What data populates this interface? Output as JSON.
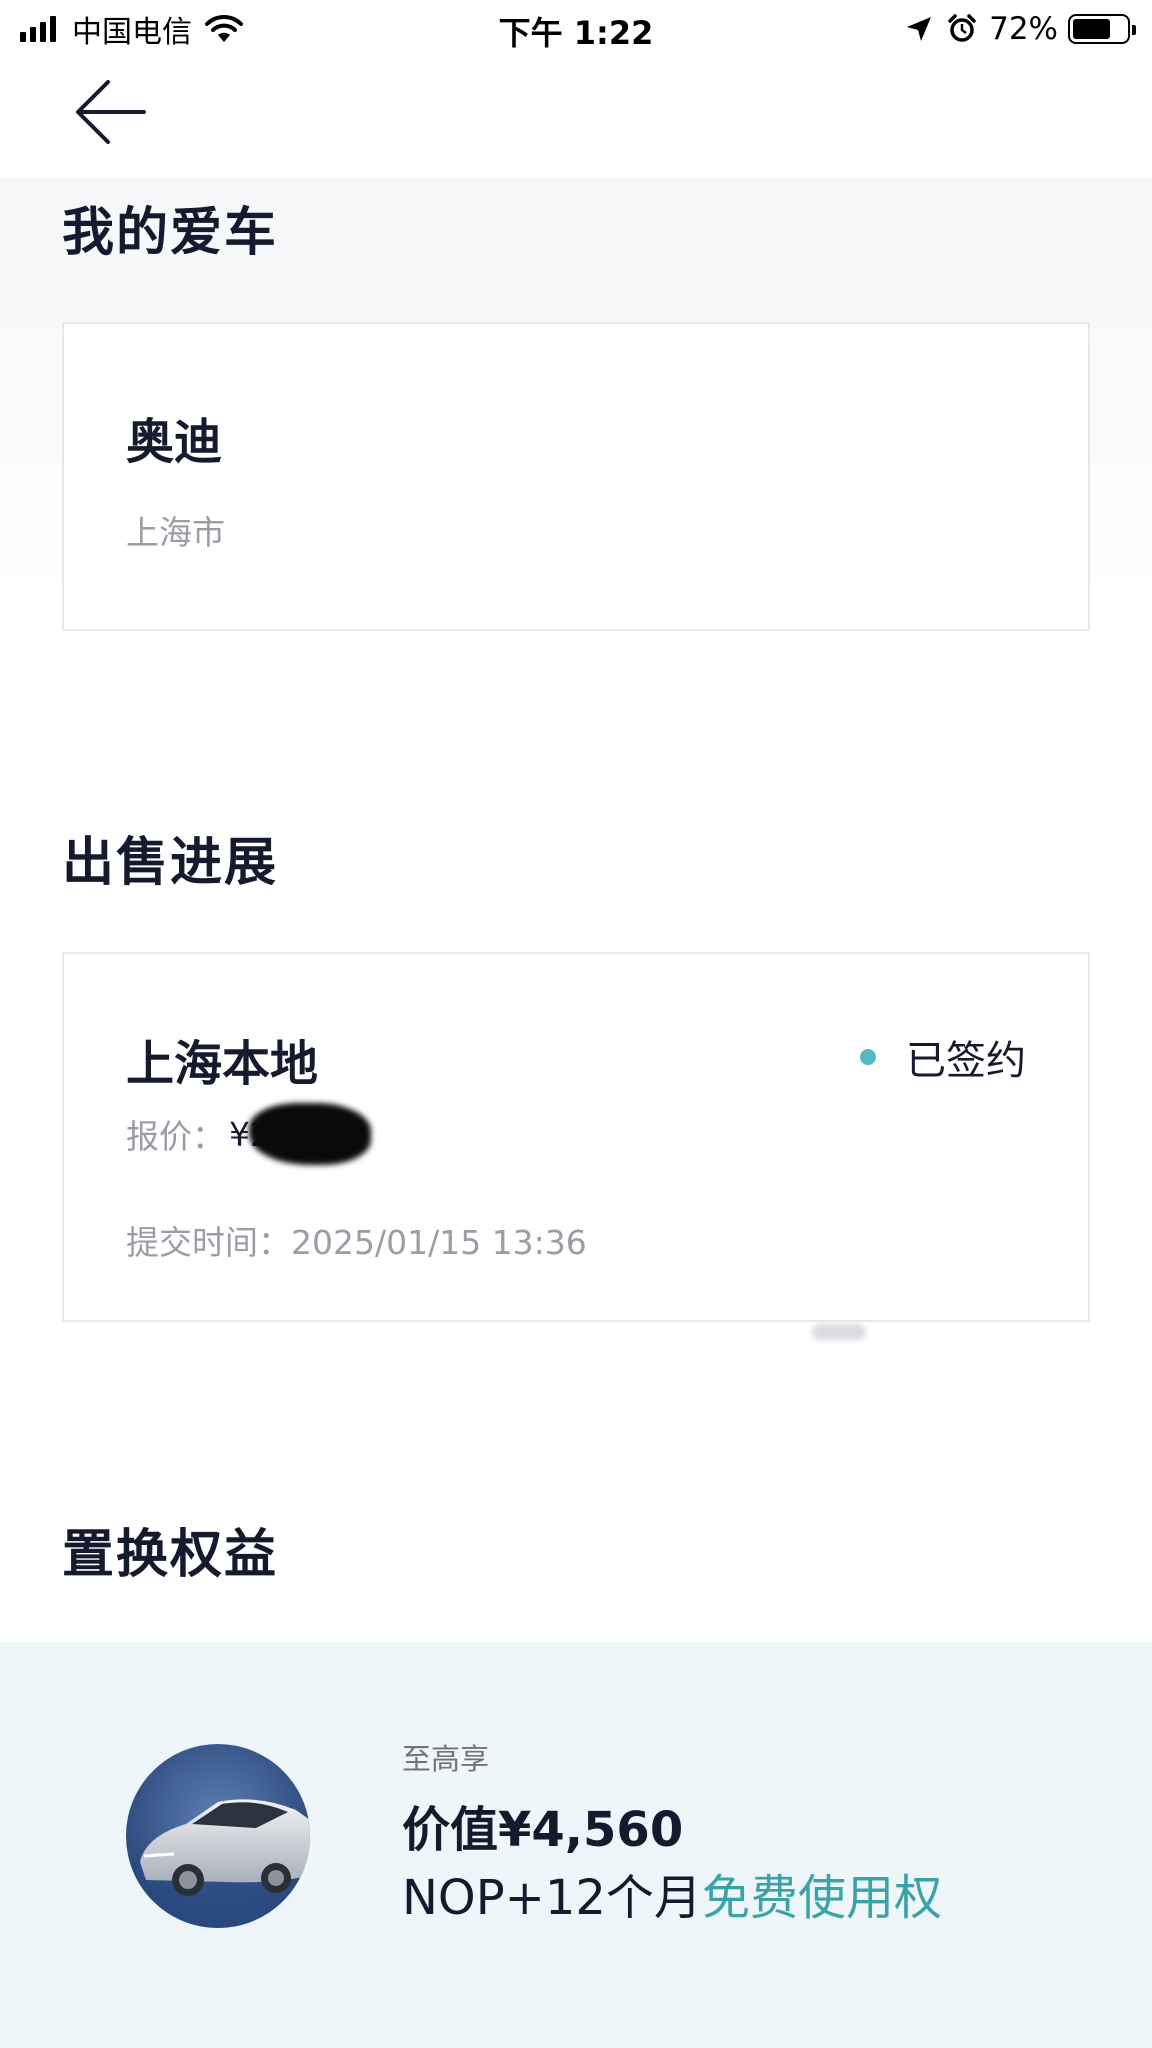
{
  "status_bar": {
    "carrier": "中国电信",
    "time": "下午 1:22",
    "battery_percent": "72%",
    "battery_level": 0.72
  },
  "sections": {
    "my_car": {
      "title": "我的爱车",
      "brand": "奥迪",
      "city": "上海市"
    },
    "sale_progress": {
      "title": "出售进展",
      "channel": "上海本地",
      "status": "已签约",
      "status_color": "#56b7c4",
      "price_label": "报价：",
      "price_value": "¥2**00",
      "submit_label": "提交时间：",
      "submit_time": "2025/01/15 13:36"
    },
    "trade_in": {
      "title": "置换权益",
      "prefix": "至高享",
      "value": "价值¥4,560",
      "desc_plain": "NOP+12个月",
      "desc_highlight": "免费使用权",
      "highlight_color": "#3aa3a8"
    }
  },
  "icons": {
    "back": "arrow-left-icon",
    "location": "location-arrow-icon",
    "alarm": "alarm-clock-icon",
    "wifi": "wifi-icon",
    "signal": "cellular-signal-icon"
  }
}
